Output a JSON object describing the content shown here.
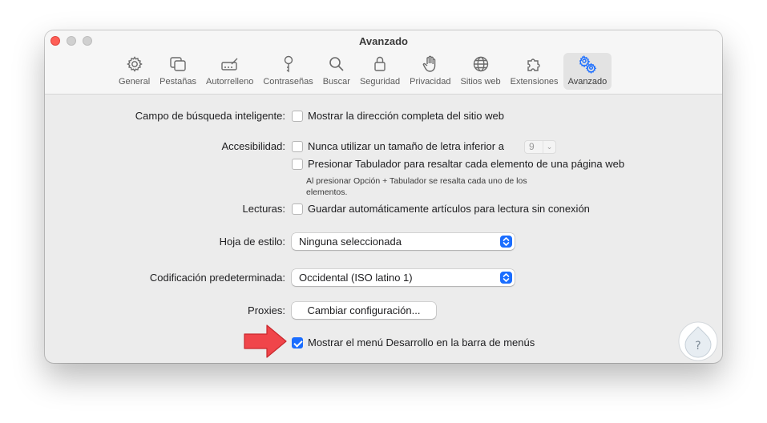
{
  "window": {
    "title": "Avanzado"
  },
  "tabs": [
    {
      "label": "General",
      "icon": "gear-icon"
    },
    {
      "label": "Pestañas",
      "icon": "tabs-icon"
    },
    {
      "label": "Autorrelleno",
      "icon": "autofill-icon"
    },
    {
      "label": "Contraseñas",
      "icon": "key-icon"
    },
    {
      "label": "Buscar",
      "icon": "search-icon"
    },
    {
      "label": "Seguridad",
      "icon": "lock-icon"
    },
    {
      "label": "Privacidad",
      "icon": "hand-icon"
    },
    {
      "label": "Sitios web",
      "icon": "globe-icon"
    },
    {
      "label": "Extensiones",
      "icon": "puzzle-icon"
    },
    {
      "label": "Avanzado",
      "icon": "gears-icon",
      "active": true
    }
  ],
  "settings": {
    "smart_search": {
      "label": "Campo de búsqueda inteligente:",
      "option": "Mostrar la dirección completa del sitio web",
      "checked": false
    },
    "accessibility": {
      "label": "Accesibilidad:",
      "option1": "Nunca utilizar un tamaño de letra inferior a",
      "option1_checked": false,
      "font_size": "9",
      "option2": "Presionar Tabulador para resaltar cada elemento de una página web",
      "option2_checked": false,
      "note": "Al presionar Opción + Tabulador se resalta cada uno de los elementos."
    },
    "reading_list": {
      "label": "Lecturas:",
      "option": "Guardar automáticamente artículos para lectura sin conexión",
      "checked": false
    },
    "style_sheet": {
      "label": "Hoja de estilo:",
      "value": "Ninguna seleccionada"
    },
    "encoding": {
      "label": "Codificación predeterminada:",
      "value": "Occidental (ISO latino 1)"
    },
    "proxies": {
      "label": "Proxies:",
      "button": "Cambiar configuración..."
    },
    "develop_menu": {
      "option": "Mostrar el menú Desarrollo en la barra de menús",
      "checked": true
    }
  },
  "accent_color": "#1a6dff",
  "annotation_arrow_color": "#f0454a"
}
